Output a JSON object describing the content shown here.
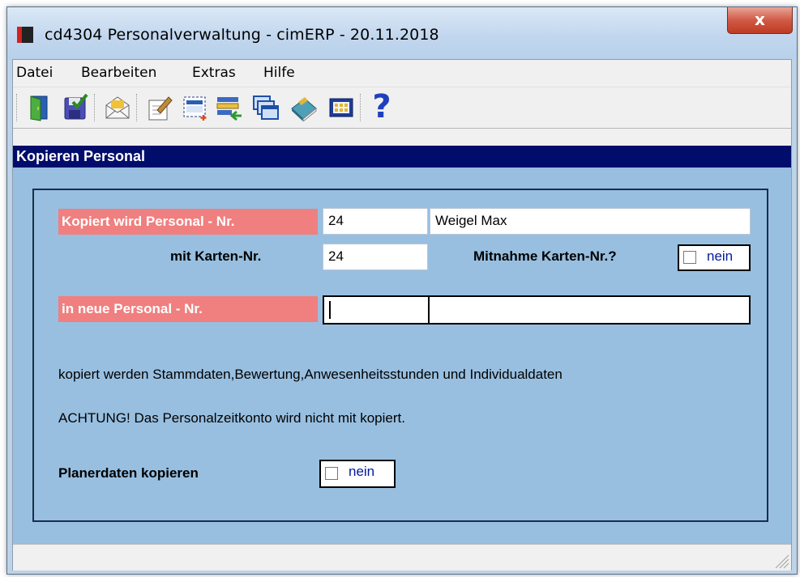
{
  "window": {
    "title": "cd4304 Personalverwaltung - cimERP - 20.11.2018",
    "close_label": "x"
  },
  "menu": {
    "items": [
      {
        "label": "Datei"
      },
      {
        "label": "Bearbeiten"
      },
      {
        "label": "Extras"
      },
      {
        "label": "Hilfe"
      }
    ]
  },
  "toolbar": {
    "icons": [
      "exit-door-icon",
      "save-icon",
      "mail-icon",
      "edit-icon",
      "new-record-icon",
      "list-transfer-icon",
      "windows-icon",
      "book-icon",
      "calculator-icon",
      "help-icon"
    ],
    "help_glyph": "?"
  },
  "section": {
    "title": "Kopieren Personal"
  },
  "form": {
    "source_label": "Kopiert wird Personal - Nr.",
    "source_number": "24",
    "source_name": "Weigel Max",
    "card_label": "mit Karten-Nr.",
    "card_number": "24",
    "take_card_label": "Mitnahme Karten-Nr.?",
    "take_card_value": "nein",
    "target_label": "in neue Personal - Nr.",
    "target_number": "",
    "target_name": "",
    "info_text": "kopiert werden Stammdaten,Bewertung,Anwesenheitsstunden und Individualdaten",
    "warning_text": "ACHTUNG! Das Personalzeitkonto wird nicht mit kopiert.",
    "planer_label": "Planerdaten kopieren",
    "planer_value": "nein"
  },
  "colors": {
    "header_bg": "#000d6b",
    "content_bg": "#98bfe0",
    "label_red": "#f07f7f",
    "checkbox_text": "#001a9c"
  }
}
